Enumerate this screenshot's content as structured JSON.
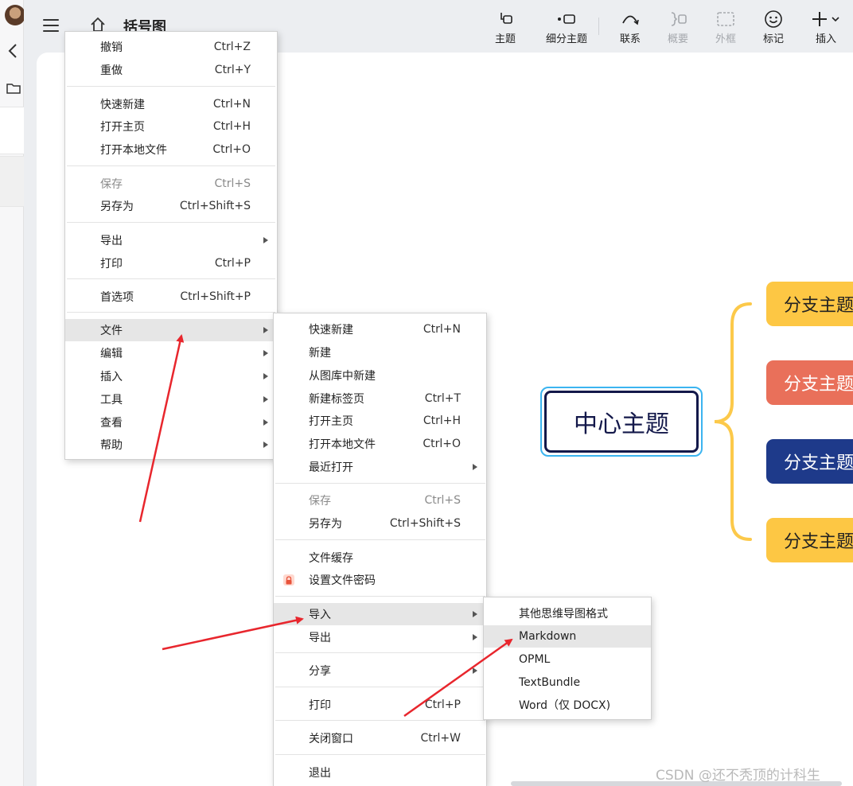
{
  "document": {
    "title": "括号图"
  },
  "toolbar": {
    "topic": "主题",
    "subtopic": "细分主题",
    "relation": "联系",
    "summary": "概要",
    "boundary": "外框",
    "marker": "标记",
    "insert": "插入"
  },
  "main_menu": {
    "items": [
      {
        "label": "撤销",
        "shortcut": "Ctrl+Z"
      },
      {
        "label": "重做",
        "shortcut": "Ctrl+Y"
      },
      {
        "label": "快速新建",
        "shortcut": "Ctrl+N"
      },
      {
        "label": "打开主页",
        "shortcut": "Ctrl+H"
      },
      {
        "label": "打开本地文件",
        "shortcut": "Ctrl+O"
      },
      {
        "label": "保存",
        "shortcut": "Ctrl+S"
      },
      {
        "label": "另存为",
        "shortcut": "Ctrl+Shift+S"
      },
      {
        "label": "导出",
        "shortcut": ""
      },
      {
        "label": "打印",
        "shortcut": "Ctrl+P"
      },
      {
        "label": "首选项",
        "shortcut": "Ctrl+Shift+P"
      },
      {
        "label": "文件",
        "shortcut": ""
      },
      {
        "label": "编辑",
        "shortcut": ""
      },
      {
        "label": "插入",
        "shortcut": ""
      },
      {
        "label": "工具",
        "shortcut": ""
      },
      {
        "label": "查看",
        "shortcut": ""
      },
      {
        "label": "帮助",
        "shortcut": ""
      }
    ]
  },
  "file_menu": {
    "items": [
      {
        "label": "快速新建",
        "shortcut": "Ctrl+N"
      },
      {
        "label": "新建",
        "shortcut": ""
      },
      {
        "label": "从图库中新建",
        "shortcut": ""
      },
      {
        "label": "新建标签页",
        "shortcut": "Ctrl+T"
      },
      {
        "label": "打开主页",
        "shortcut": "Ctrl+H"
      },
      {
        "label": "打开本地文件",
        "shortcut": "Ctrl+O"
      },
      {
        "label": "最近打开",
        "shortcut": ""
      },
      {
        "label": "保存",
        "shortcut": "Ctrl+S"
      },
      {
        "label": "另存为",
        "shortcut": "Ctrl+Shift+S"
      },
      {
        "label": "文件缓存",
        "shortcut": ""
      },
      {
        "label": "设置文件密码",
        "shortcut": ""
      },
      {
        "label": "导入",
        "shortcut": ""
      },
      {
        "label": "导出",
        "shortcut": ""
      },
      {
        "label": "分享",
        "shortcut": ""
      },
      {
        "label": "打印",
        "shortcut": "Ctrl+P"
      },
      {
        "label": "关闭窗口",
        "shortcut": "Ctrl+W"
      },
      {
        "label": "退出",
        "shortcut": ""
      }
    ]
  },
  "import_menu": {
    "items": [
      {
        "label": "其他思维导图格式"
      },
      {
        "label": "Markdown"
      },
      {
        "label": "OPML"
      },
      {
        "label": "TextBundle"
      },
      {
        "label": "Word（仅 DOCX)"
      }
    ]
  },
  "mindmap": {
    "center": "中心主题",
    "branches": [
      {
        "label": "分支主题",
        "color": "#fdc744"
      },
      {
        "label": "分支主题",
        "color": "#e9705a"
      },
      {
        "label": "分支主题",
        "color": "#1e3a8a"
      },
      {
        "label": "分支主题",
        "color": "#fdc744"
      }
    ],
    "brace_color": "#fcc94a"
  },
  "colors": {
    "annotation_arrow": "#e8262d",
    "menu_highlight": "#e6e6e6"
  },
  "watermark": "CSDN @还不秃顶的计科生"
}
